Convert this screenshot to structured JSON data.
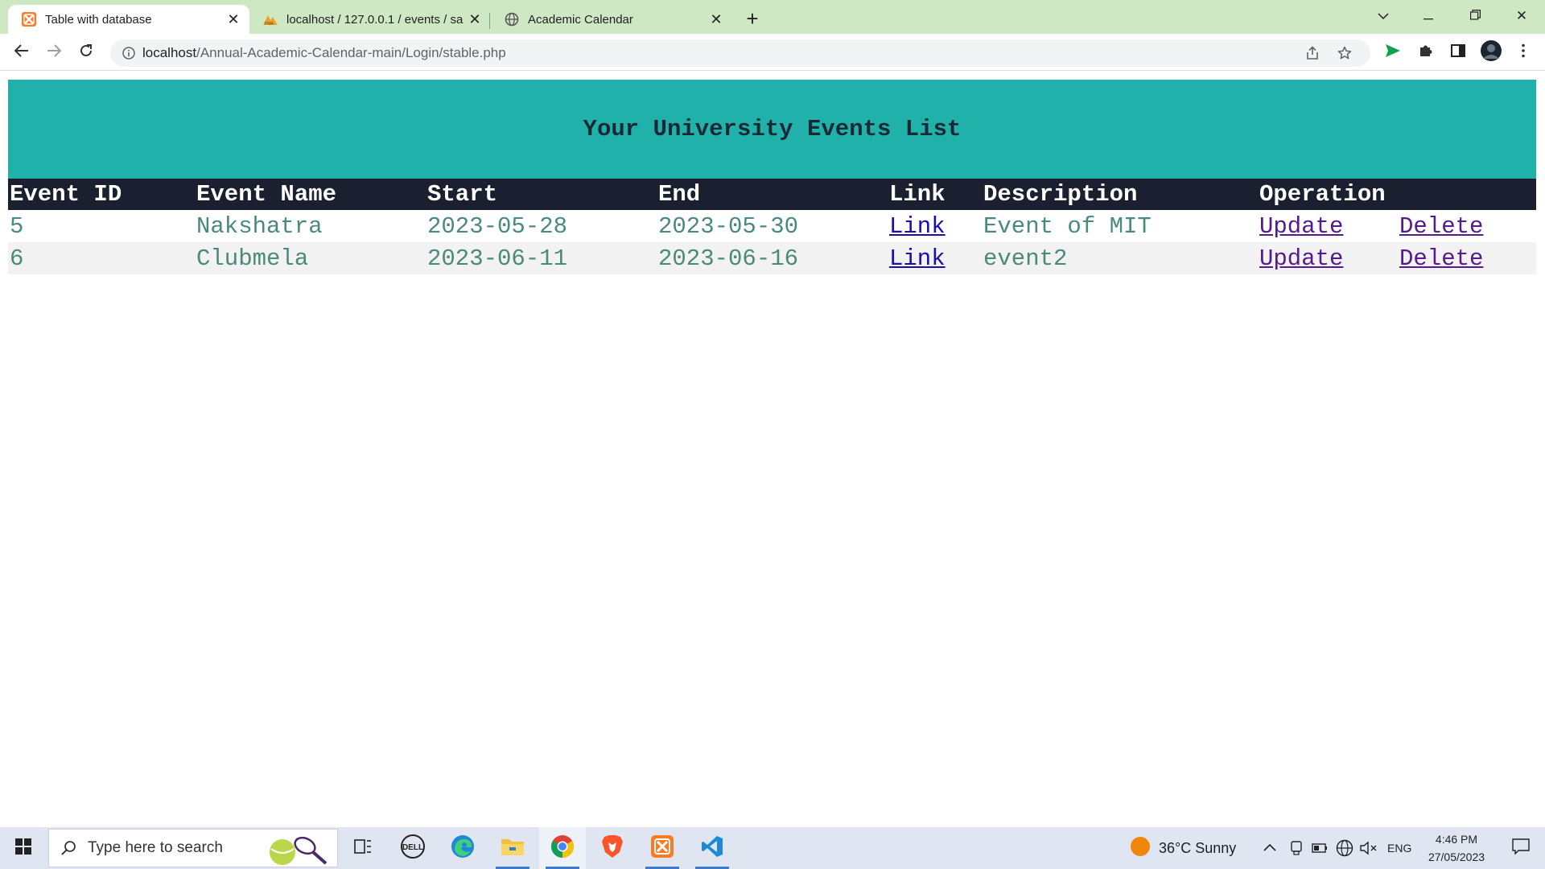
{
  "browser": {
    "tabs": [
      {
        "title": "Table with database",
        "active": true
      },
      {
        "title": "localhost / 127.0.0.1 / events / sa",
        "active": false
      },
      {
        "title": "Academic Calendar",
        "active": false
      }
    ],
    "address": {
      "host": "localhost",
      "path": "/Annual-Academic-Calendar-main/Login/stable.php"
    }
  },
  "page": {
    "heading": "Your University Events List",
    "table": {
      "headers": [
        "Event ID",
        "Event Name",
        "Start",
        "End",
        "Link",
        "Description",
        "Operation"
      ],
      "rows": [
        {
          "id": "5",
          "name": "Nakshatra",
          "start": "2023-05-28",
          "end": "2023-05-30",
          "link": "Link",
          "description": "Event of MIT",
          "update": "Update",
          "delete": "Delete"
        },
        {
          "id": "6",
          "name": "Clubmela",
          "start": "2023-06-11",
          "end": "2023-06-16",
          "link": "Link",
          "description": "event2",
          "update": "Update",
          "delete": "Delete"
        }
      ]
    }
  },
  "taskbar": {
    "search_placeholder": "Type here to search",
    "weather": "36°C  Sunny",
    "language": "ENG",
    "time": "4:46 PM",
    "date": "27/05/2023"
  },
  "colors": {
    "tabstrip": "#cfe8c4",
    "heading_band": "#20b2aa",
    "table_header": "#1b2030",
    "cell_text": "#4a8a7a",
    "link": "#1a0dab",
    "link_visited": "#551a8b"
  },
  "icons": [
    "xampp-icon",
    "phpmyadmin-icon",
    "globe-icon",
    "close-icon",
    "plus-icon",
    "chevron-down-icon",
    "minimize-icon",
    "restore-icon",
    "back-icon",
    "forward-icon",
    "reload-icon",
    "info-icon",
    "share-icon",
    "star-icon",
    "send-icon",
    "puzzle-icon",
    "sidepanel-icon",
    "avatar",
    "menu-icon",
    "windows-icon",
    "search-icon",
    "task-view-icon",
    "dell-icon",
    "edge-icon",
    "file-explorer-icon",
    "chrome-icon",
    "brave-icon",
    "vscode-icon",
    "weather-icon",
    "notification-icon"
  ]
}
